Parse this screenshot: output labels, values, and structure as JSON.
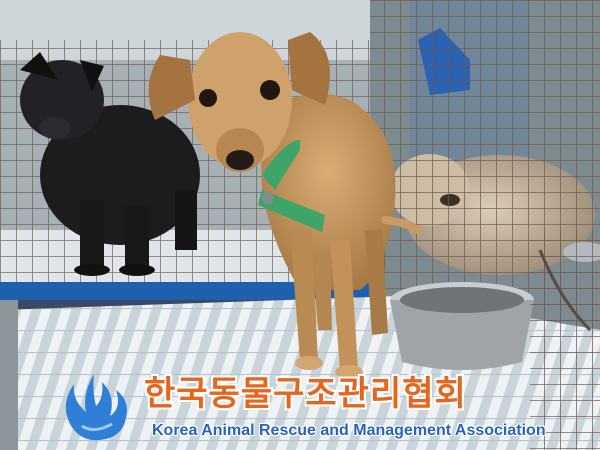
{
  "photo": {
    "subjects": [
      "tan-dog",
      "black-dog",
      "fluffy-dog"
    ],
    "colors": {
      "tan_dog": "#c89a62",
      "black_dog": "#1c1c1e",
      "fluffy_dog": "#c9b9a3",
      "cage_wire": "#6e5a4e",
      "floor_grate": "#e6ecf0",
      "bowl": "#9ea4a8",
      "collar": "#3fa46a",
      "blue_trim": "#1e5fae"
    }
  },
  "watermark": {
    "korean": "한국동물구조관리협회",
    "english": "Korea Animal Rescue and Management Association",
    "korean_color": "#e8651e",
    "english_color": "#2a63b8",
    "logo": "blue-flame-logo"
  }
}
